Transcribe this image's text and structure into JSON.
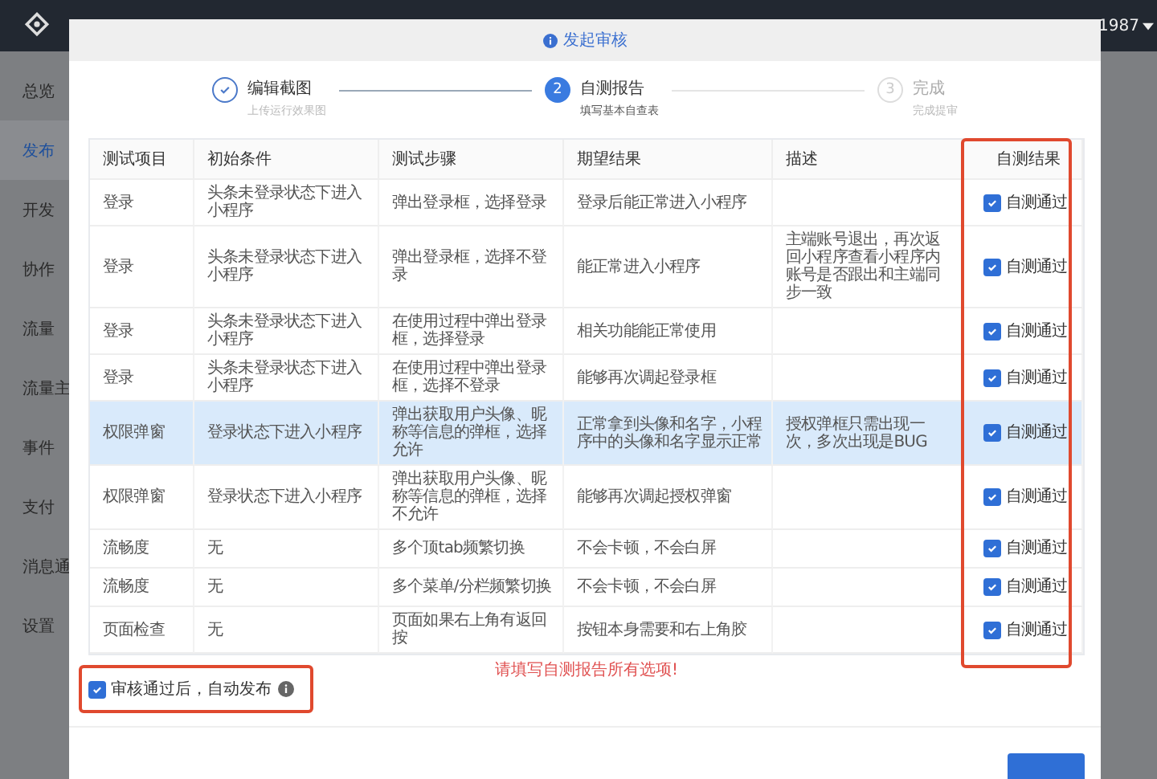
{
  "topbar": {
    "user": "1987"
  },
  "sidebar": {
    "items": [
      {
        "label": "总览",
        "selected": false
      },
      {
        "label": "发布",
        "selected": true
      },
      {
        "label": "开发",
        "selected": false
      },
      {
        "label": "协作",
        "selected": false
      },
      {
        "label": "流量",
        "selected": false
      },
      {
        "label": "流量主",
        "selected": false
      },
      {
        "label": "事件",
        "selected": false
      },
      {
        "label": "支付",
        "selected": false
      },
      {
        "label": "消息通",
        "selected": false
      },
      {
        "label": "设置",
        "selected": false
      }
    ]
  },
  "dialog": {
    "title": "发起审核",
    "steps": [
      {
        "title": "编辑截图",
        "subtitle": "上传运行效果图",
        "done": true,
        "current": false
      },
      {
        "title": "自测报告",
        "subtitle": "填写基本自查表",
        "done": false,
        "current": true
      },
      {
        "title": "完成",
        "subtitle": "完成提审",
        "done": false,
        "current": false,
        "number": "3"
      }
    ],
    "current_step_number": "2",
    "table": {
      "columns": [
        "测试项目",
        "初始条件",
        "测试步骤",
        "期望结果",
        "描述",
        "自测结果"
      ],
      "rows": [
        {
          "item": "登录",
          "condition": "头条未登录状态下进入小程序",
          "steps": "弹出登录框，选择登录",
          "expected": "登录后能正常进入小程序",
          "result": "自测通过",
          "checked": true,
          "highlighted": false
        },
        {
          "item": "登录",
          "condition": "头条未登录状态下进入小程序",
          "steps": "弹出登录框，选择不登录",
          "expected": "能正常进入小程序",
          "description": "主端账号退出，再次返回小程序查看小程序内账号是否跟出和主端同步一致",
          "result": "自测通过",
          "checked": true,
          "highlighted": false
        },
        {
          "item": "登录",
          "condition": "头条未登录状态下进入小程序",
          "steps": "在使用过程中弹出登录框，选择登录",
          "expected": "相关功能能正常使用",
          "result": "自测通过",
          "checked": true,
          "highlighted": false
        },
        {
          "item": "登录",
          "condition": "头条未登录状态下进入小程序",
          "steps": "在使用过程中弹出登录框，选择不登录",
          "expected": "能够再次调起登录框",
          "result": "自测通过",
          "checked": true,
          "highlighted": false
        },
        {
          "item": "权限弹窗",
          "condition": "登录状态下进入小程序",
          "steps": "弹出获取用户头像、昵称等信息的弹框，选择允许",
          "expected": "正常拿到头像和名字，小程序中的头像和名字显示正常",
          "description": "授权弹框只需出现一次，多次出现是BUG",
          "result": "自测通过",
          "checked": true,
          "highlighted": true
        },
        {
          "item": "权限弹窗",
          "condition": "登录状态下进入小程序",
          "steps": "弹出获取用户头像、昵称等信息的弹框，选择不允许",
          "expected": "能够再次调起授权弹窗",
          "result": "自测通过",
          "checked": true,
          "highlighted": false
        },
        {
          "item": "流畅度",
          "condition": "无",
          "steps": "多个顶tab频繁切换",
          "expected": "不会卡顿，不会白屏",
          "result": "自测通过",
          "checked": true,
          "highlighted": false
        },
        {
          "item": "流畅度",
          "condition": "无",
          "steps": "多个菜单/分栏频繁切换",
          "expected": "不会卡顿，不会白屏",
          "result": "自测通过",
          "checked": true,
          "highlighted": false
        },
        {
          "item": "页面检查",
          "condition": "无",
          "steps": "页面如果右上角有返回按",
          "expected": "按钮本身需要和右上角胶",
          "result": "自测通过",
          "checked": true,
          "highlighted": false
        }
      ]
    },
    "warning": "请填写自测报告所有选项!",
    "auto_publish": {
      "label": "审核通过后，自动发布",
      "checked": true
    }
  }
}
